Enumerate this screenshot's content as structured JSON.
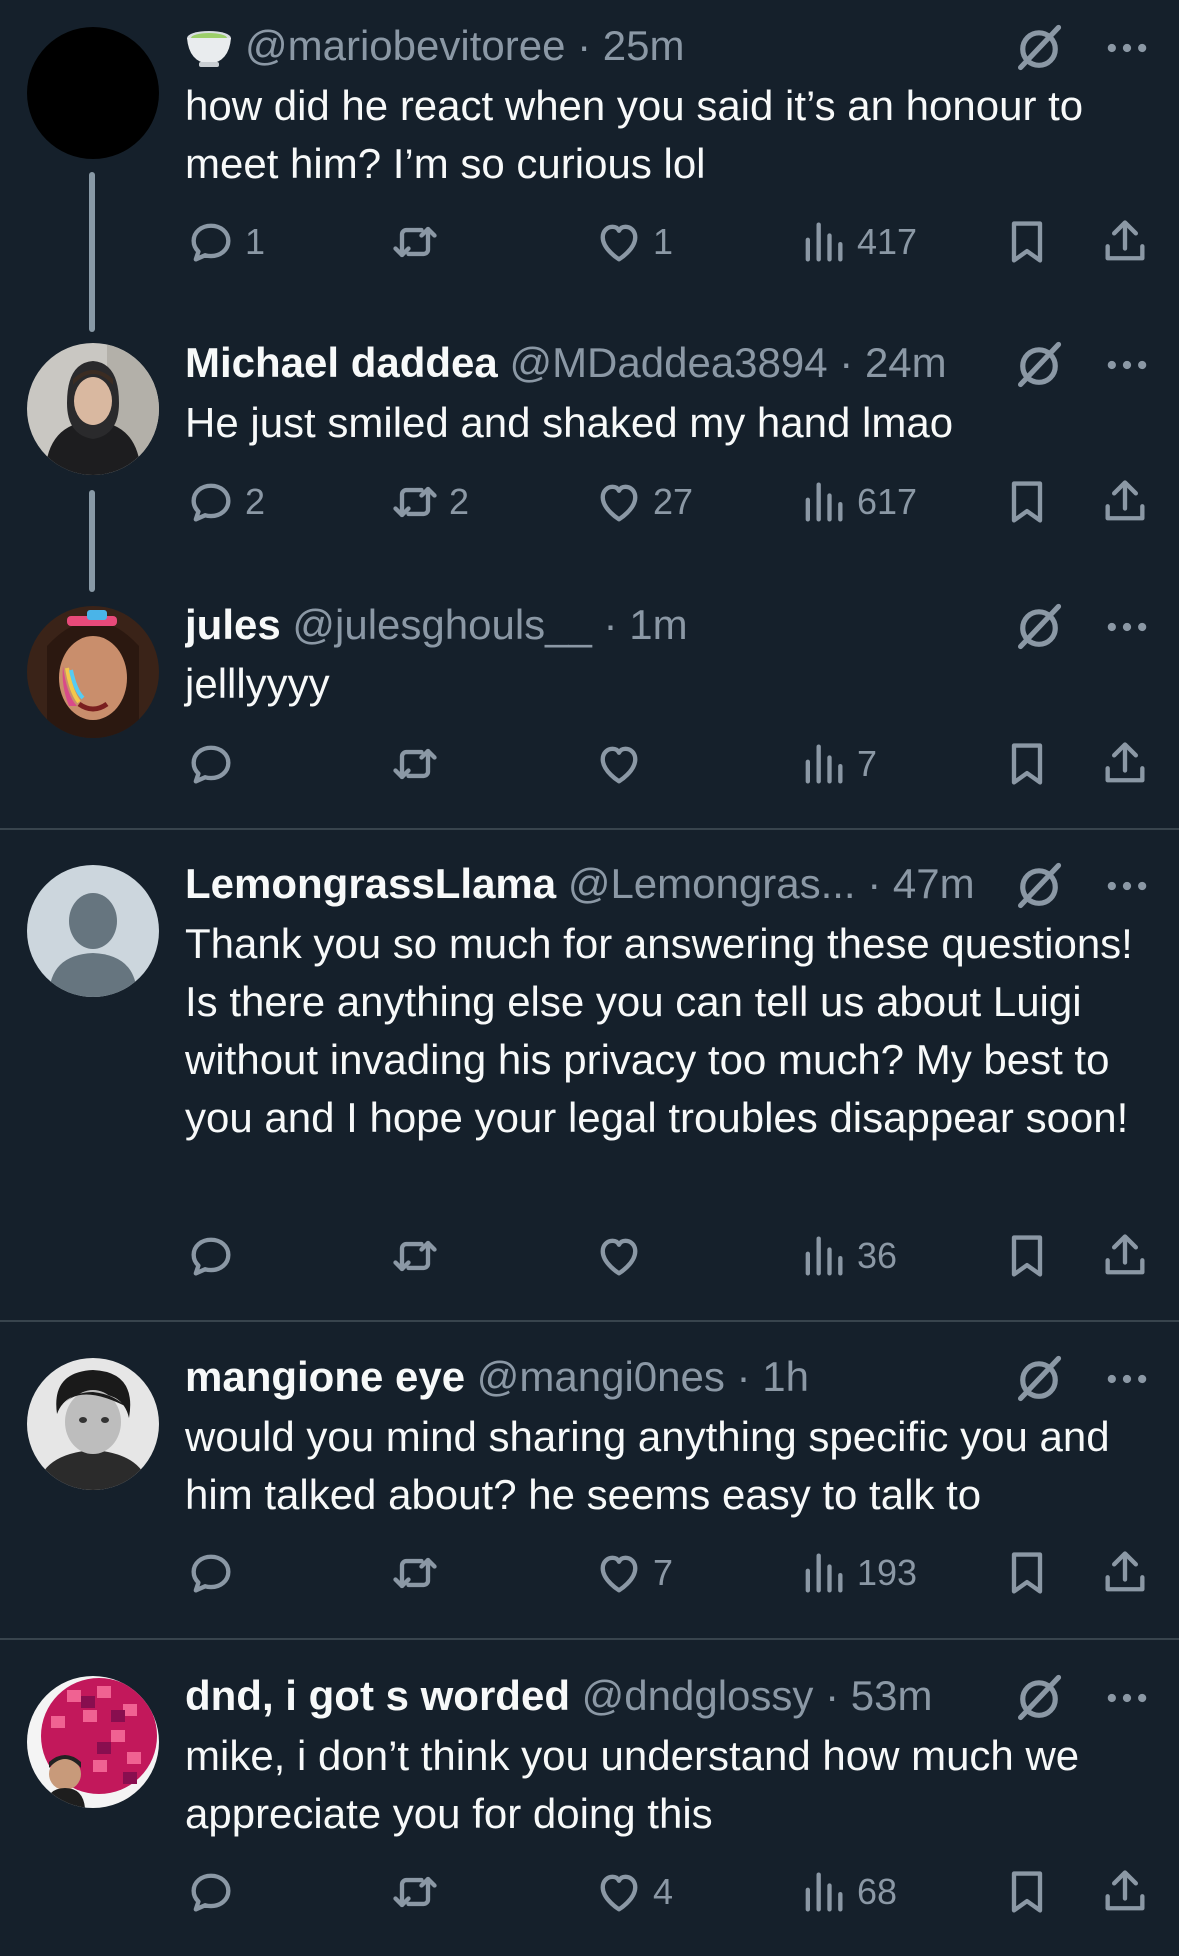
{
  "posts": [
    {
      "name": "",
      "handle": "@mariobevitoree",
      "time": "25m",
      "text": "how did he react when you said it’s an honour to meet him? I’m so curious lol",
      "replies": "1",
      "reposts": "",
      "likes": "1",
      "views": "417",
      "avatar": "black-circle",
      "has_emoji": true
    },
    {
      "name": "Michael daddea",
      "handle": "@MDaddea3894",
      "time": "24m",
      "text": "He just smiled and shaked my hand lmao",
      "replies": "2",
      "reposts": "2",
      "likes": "27",
      "views": "617",
      "avatar": "photo-hooded-person"
    },
    {
      "name": "jules",
      "handle": "@julesghouls__",
      "time": "1m",
      "text": "jelllyyyy",
      "replies": "",
      "reposts": "",
      "likes": "",
      "views": "7",
      "avatar": "photo-face-paint"
    },
    {
      "name": "LemongrassLlama",
      "handle": "@Lemongras...",
      "time": "47m",
      "text": "Thank you so much for answering these questions! Is there anything else you can tell us about Luigi without invading his privacy too much? My best to you and I hope your legal troubles disappear soon!",
      "replies": "",
      "reposts": "",
      "likes": "",
      "views": "36",
      "avatar": "default-avatar"
    },
    {
      "name": "mangione eye",
      "handle": "@mangi0nes",
      "time": "1h",
      "text": "would you mind sharing anything specific you and him talked about? he seems easy to talk to",
      "replies": "",
      "reposts": "",
      "likes": "7",
      "views": "193",
      "avatar": "photo-bw-person"
    },
    {
      "name": "dnd, i got s worded",
      "handle": "@dndglossy",
      "time": "53m",
      "text": "mike, i don’t think you understand how much we appreciate you for doing this",
      "replies": "",
      "reposts": "",
      "likes": "4",
      "views": "68",
      "avatar": "disco-ball"
    }
  ],
  "colors": {
    "background": "#15202b",
    "text_primary": "#f7f9f9",
    "text_secondary": "#8b98a5",
    "divider": "#38444d",
    "thread_line": "#8899a6"
  },
  "icons": [
    "reply-icon",
    "repost-icon",
    "like-icon",
    "views-icon",
    "bookmark-icon",
    "share-icon",
    "grok-icon",
    "more-icon",
    "tea-emoji-icon"
  ]
}
